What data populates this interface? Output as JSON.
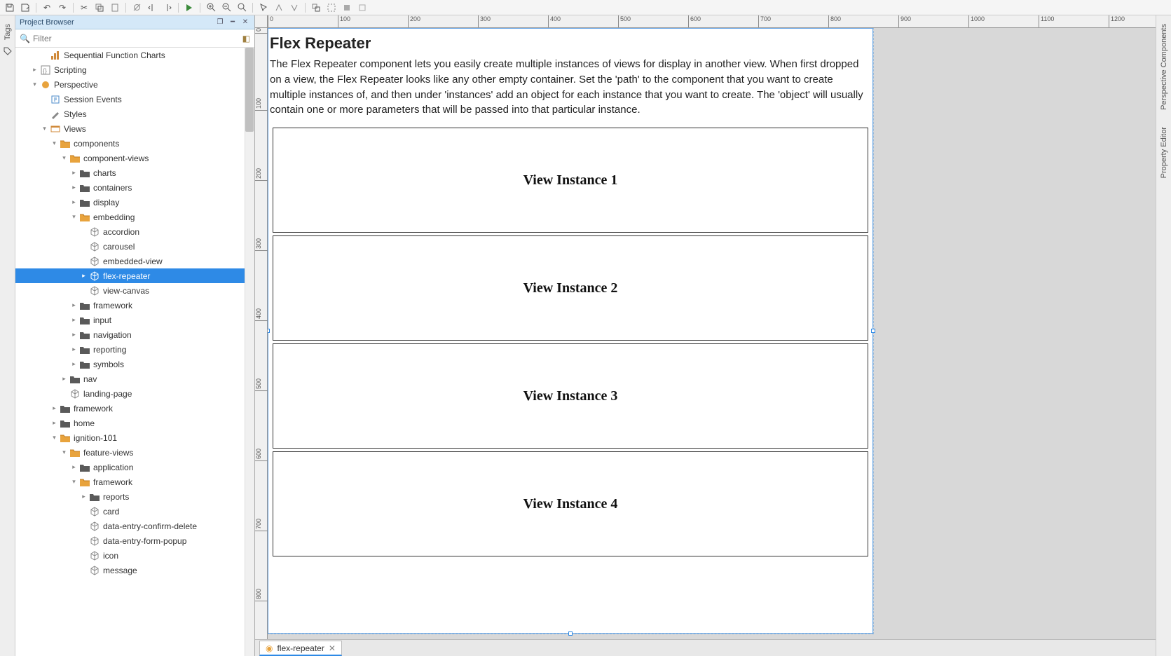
{
  "toolbar": {
    "buttons": [
      "save",
      "save-as",
      "undo",
      "redo",
      "cut",
      "copy",
      "paste",
      "delete-scripts",
      "toggle-1",
      "toggle-2",
      "toggle-3",
      "play",
      "zoom-in",
      "zoom-out",
      "zoom-fit",
      "cursor",
      "pan-1",
      "pan-2",
      "group",
      "ungroup",
      "align-1",
      "align-2"
    ]
  },
  "leftDock": {
    "tagsLabel": "Tags"
  },
  "rightDock": {
    "componentsLabel": "Perspective Components",
    "propsLabel": "Property Editor"
  },
  "panel": {
    "title": "Project Browser",
    "filterPlaceholder": "Filter"
  },
  "tree": [
    {
      "d": 2,
      "c": "",
      "i": "chart",
      "l": "Sequential Function Charts"
    },
    {
      "d": 1,
      "c": "▸",
      "i": "script",
      "l": "Scripting"
    },
    {
      "d": 1,
      "c": "▾",
      "i": "persp",
      "l": "Perspective"
    },
    {
      "d": 2,
      "c": "",
      "i": "events",
      "l": "Session Events"
    },
    {
      "d": 2,
      "c": "",
      "i": "styles",
      "l": "Styles"
    },
    {
      "d": 2,
      "c": "▾",
      "i": "views",
      "l": "Views"
    },
    {
      "d": 3,
      "c": "▾",
      "i": "fo",
      "l": "components"
    },
    {
      "d": 4,
      "c": "▾",
      "i": "fo",
      "l": "component-views"
    },
    {
      "d": 5,
      "c": "▸",
      "i": "fc",
      "l": "charts"
    },
    {
      "d": 5,
      "c": "▸",
      "i": "fc",
      "l": "containers"
    },
    {
      "d": 5,
      "c": "▸",
      "i": "fc",
      "l": "display"
    },
    {
      "d": 5,
      "c": "▾",
      "i": "fo",
      "l": "embedding"
    },
    {
      "d": 6,
      "c": "",
      "i": "cube",
      "l": "accordion"
    },
    {
      "d": 6,
      "c": "",
      "i": "cube",
      "l": "carousel"
    },
    {
      "d": 6,
      "c": "",
      "i": "cube",
      "l": "embedded-view"
    },
    {
      "d": 6,
      "c": "▸",
      "i": "cube",
      "l": "flex-repeater",
      "sel": true
    },
    {
      "d": 6,
      "c": "",
      "i": "cube",
      "l": "view-canvas"
    },
    {
      "d": 5,
      "c": "▸",
      "i": "fc",
      "l": "framework"
    },
    {
      "d": 5,
      "c": "▸",
      "i": "fc",
      "l": "input"
    },
    {
      "d": 5,
      "c": "▸",
      "i": "fc",
      "l": "navigation"
    },
    {
      "d": 5,
      "c": "▸",
      "i": "fc",
      "l": "reporting"
    },
    {
      "d": 5,
      "c": "▸",
      "i": "fc",
      "l": "symbols"
    },
    {
      "d": 4,
      "c": "▸",
      "i": "fc",
      "l": "nav"
    },
    {
      "d": 4,
      "c": "",
      "i": "cube",
      "l": "landing-page"
    },
    {
      "d": 3,
      "c": "▸",
      "i": "fc",
      "l": "framework"
    },
    {
      "d": 3,
      "c": "▸",
      "i": "fc",
      "l": "home"
    },
    {
      "d": 3,
      "c": "▾",
      "i": "fo",
      "l": "ignition-101"
    },
    {
      "d": 4,
      "c": "▾",
      "i": "fo",
      "l": "feature-views"
    },
    {
      "d": 5,
      "c": "▸",
      "i": "fc",
      "l": "application"
    },
    {
      "d": 5,
      "c": "▾",
      "i": "fo",
      "l": "framework"
    },
    {
      "d": 6,
      "c": "▸",
      "i": "fc",
      "l": "reports"
    },
    {
      "d": 6,
      "c": "",
      "i": "cube",
      "l": "card"
    },
    {
      "d": 6,
      "c": "",
      "i": "cube",
      "l": "data-entry-confirm-delete"
    },
    {
      "d": 6,
      "c": "",
      "i": "cube",
      "l": "data-entry-form-popup"
    },
    {
      "d": 6,
      "c": "",
      "i": "cube",
      "l": "icon"
    },
    {
      "d": 6,
      "c": "",
      "i": "cube",
      "l": "message"
    }
  ],
  "rulerH": [
    0,
    100,
    200,
    300,
    400,
    500,
    600,
    700,
    800,
    900,
    1000,
    1100,
    1200
  ],
  "rulerV": [
    0,
    100,
    200,
    300,
    400,
    500,
    600,
    700,
    800
  ],
  "canvas": {
    "title": "Flex Repeater",
    "desc": "The Flex Repeater component lets you easily create multiple instances of views for display in another view. When first dropped on a view, the Flex Repeater looks like any other empty container. Set the 'path' to the component that you want to create multiple instances of, and then under 'instances' add an object for each instance that you want to create. The 'object' will usually contain one or more parameters that will be passed into that particular instance.",
    "instances": [
      "View Instance 1",
      "View Instance 2",
      "View Instance 3",
      "View Instance 4"
    ]
  },
  "bottomTab": {
    "label": "flex-repeater"
  }
}
